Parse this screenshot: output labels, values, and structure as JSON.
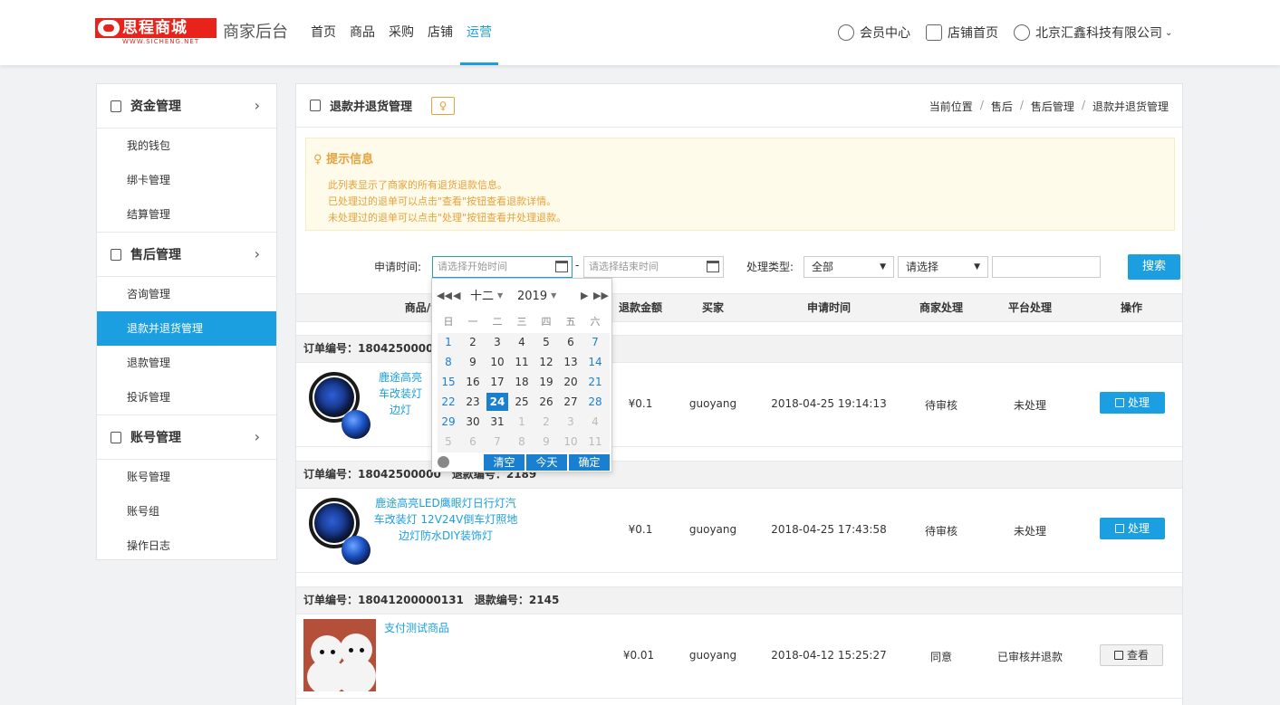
{
  "header": {
    "logo_text": "思程商城",
    "logo_sub": "WWW.SICHENG.NET",
    "app_title": "商家后台",
    "nav": [
      {
        "label": "首页",
        "active": false
      },
      {
        "label": "商品",
        "active": false
      },
      {
        "label": "采购",
        "active": false
      },
      {
        "label": "店铺",
        "active": false
      },
      {
        "label": "运营",
        "active": true
      }
    ],
    "member_center": "会员中心",
    "store_home": "店铺首页",
    "company": "北京汇鑫科技有限公司"
  },
  "sidebar": {
    "groups": [
      {
        "label": "资金管理",
        "items": [
          "我的钱包",
          "绑卡管理",
          "结算管理"
        ]
      },
      {
        "label": "售后管理",
        "items": [
          "咨询管理",
          "退款并退货管理",
          "退款管理",
          "投诉管理"
        ],
        "active_item": "退款并退货管理"
      },
      {
        "label": "账号管理",
        "items": [
          "账号管理",
          "账号组",
          "操作日志"
        ]
      }
    ]
  },
  "panel": {
    "title": "退款并退货管理",
    "breadcrumb": [
      "当前位置",
      "售后",
      "售后管理",
      "退款并退货管理"
    ]
  },
  "notice": {
    "title": "提示信息",
    "lines": [
      "此列表显示了商家的所有退货退款信息。",
      "已处理过的退单可以点击\"查看\"按钮查看退款详情。",
      "未处理过的退单可以点击\"处理\"按钮查看并处理退款。"
    ]
  },
  "filter": {
    "apply_time_label": "申请时间:",
    "start_placeholder": "请选择开始时间",
    "end_placeholder": "请选择结束时间",
    "dash": "-",
    "type_label": "处理类型:",
    "type_value": "全部",
    "second_select": "请选择",
    "search_button": "搜索"
  },
  "table": {
    "headers": [
      "商品/订",
      "退款金额",
      "买家",
      "申请时间",
      "商家处理",
      "平台处理",
      "操作"
    ],
    "orders": [
      {
        "order_bar": "订单编号：18042500001",
        "refund_no": "",
        "product_lines": [
          "鹿途高亮",
          "车改装灯",
          "边灯"
        ],
        "amount": "¥0.1",
        "buyer": "guoyang",
        "time": "2018-04-25 19:14:13",
        "merchant_status": "待审核",
        "platform_status": "未处理",
        "action": "处理",
        "image": "lamp"
      },
      {
        "order_bar": "订单编号：18042500000",
        "refund_no": "退款编号：2189",
        "product_lines": [
          "鹿途高亮LED鹰眼灯日行灯汽",
          "车改装灯 12V24V倒车灯照地",
          "边灯防水DIY装饰灯"
        ],
        "amount": "¥0.1",
        "buyer": "guoyang",
        "time": "2018-04-25 17:43:58",
        "merchant_status": "待审核",
        "platform_status": "未处理",
        "action": "处理",
        "image": "lamp"
      },
      {
        "order_bar": "订单编号：18041200000131",
        "refund_no": "退款编号：2145",
        "product_lines": [
          "支付测试商品"
        ],
        "amount": "¥0.01",
        "buyer": "guoyang",
        "time": "2018-04-12 15:25:27",
        "merchant_status": "同意",
        "platform_status": "已审核并退款",
        "action": "查看",
        "image": "dog"
      }
    ]
  },
  "calendar": {
    "month": "十二",
    "year": "2019",
    "weekdays": [
      "日",
      "一",
      "二",
      "三",
      "四",
      "五",
      "六"
    ],
    "weeks": [
      [
        "1",
        "2",
        "3",
        "4",
        "5",
        "6",
        "7"
      ],
      [
        "8",
        "9",
        "10",
        "11",
        "12",
        "13",
        "14"
      ],
      [
        "15",
        "16",
        "17",
        "18",
        "19",
        "20",
        "21"
      ],
      [
        "22",
        "23",
        "24",
        "25",
        "26",
        "27",
        "28"
      ],
      [
        "29",
        "30",
        "31",
        "1",
        "2",
        "3",
        "4"
      ],
      [
        "5",
        "6",
        "7",
        "8",
        "9",
        "10",
        "11"
      ]
    ],
    "selected_day": "24",
    "buttons": [
      "清空",
      "今天",
      "确定"
    ]
  }
}
